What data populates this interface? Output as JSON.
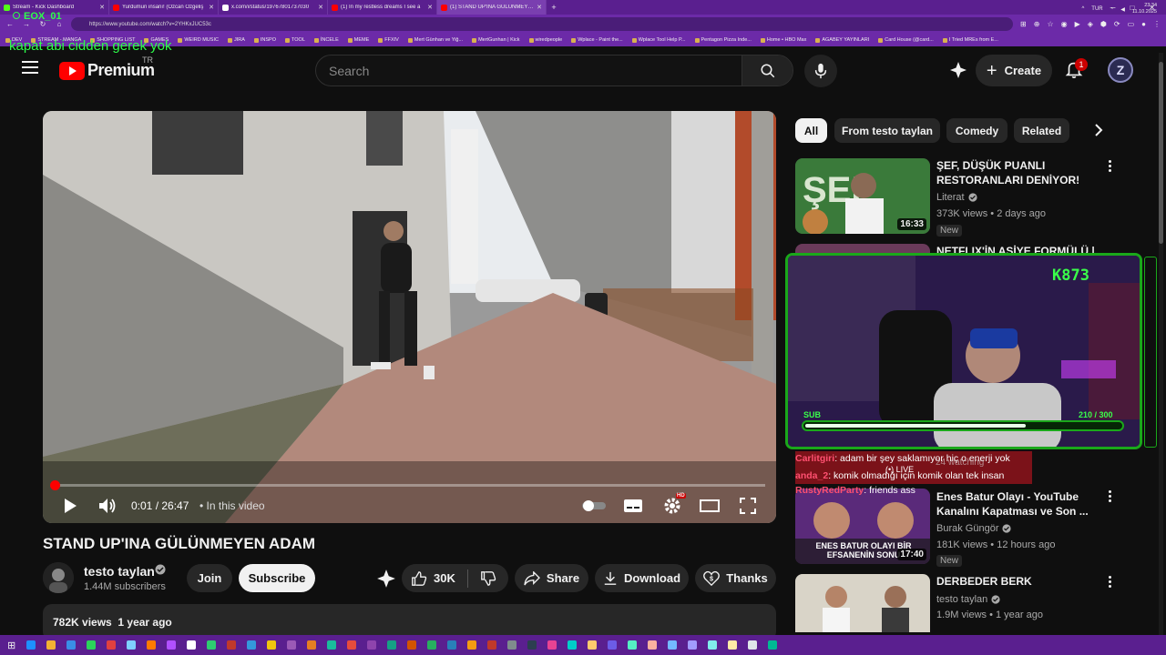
{
  "browser": {
    "tabs": [
      {
        "title": "Stream - Kick Dashboard",
        "color": "#53fc18"
      },
      {
        "title": "Yurdumun insanı! (Özcan Özgeliş",
        "color": "#ff0000"
      },
      {
        "title": "x.com/i/status/19767801737030",
        "color": "#ffffff"
      },
      {
        "title": "(1) In my restless dreams I see a",
        "color": "#ff0000"
      },
      {
        "title": "(1) STAND UP'INA GÜLÜNMEYEN",
        "color": "#ff0000",
        "active": true
      }
    ],
    "new_tab": "+",
    "url": "https://www.youtube.com/watch?v=2YHKxJUC53c",
    "bookmarks": [
      "DEV",
      "STREAM - MANGA",
      "SHOPPING LIST",
      "GAMES",
      "WEIRD MUSIC",
      "JIRA",
      "INSPO",
      "TOOL",
      "İNCELE",
      "MEME",
      "FFXIV",
      "Mert Günhan ve Yiğ...",
      "MertGunhan | Kick",
      "wiredpeople",
      "Wplace - Paint the...",
      "Wplace Tool Help P...",
      "Pentagon Pizza Inde...",
      "Home • HBO Max",
      "AGABEY YAYINLARI",
      "Card House (@card...",
      "I Tried MREs from E..."
    ]
  },
  "overlay": {
    "user": "EOX_01",
    "message": "kapat abi cidden gerek yok"
  },
  "masthead": {
    "logo_text": "Premium",
    "region": "TR",
    "search_placeholder": "Search",
    "create_label": "Create",
    "notification_count": "1",
    "avatar_letter": "Z"
  },
  "player": {
    "time": "0:01 / 26:47",
    "chapter": "• In this video",
    "progress_fraction": 0.001,
    "settings_badge": "HD"
  },
  "video": {
    "title": "STAND UP'INA GÜLÜNMEYEN ADAM",
    "channel": "testo taylan",
    "subscribers": "1.44M subscribers",
    "join_label": "Join",
    "subscribe_label": "Subscribe",
    "likes": "30K",
    "share_label": "Share",
    "download_label": "Download",
    "thanks_label": "Thanks",
    "views": "782K views",
    "age": "1 year ago"
  },
  "chips": [
    "All",
    "From testo taylan",
    "Comedy",
    "Related"
  ],
  "recommendations": [
    {
      "title": "ŞEF, DÜŞÜK PUANLI RESTORANLARI DENİYOR!",
      "channel": "Literat",
      "meta": "373K views • 2 days ago",
      "duration": "16:33",
      "badge": "New"
    },
    {
      "title": "NETFLIX'İN AŞİYE FORMÜLÜ | ...",
      "channel": "",
      "meta": "",
      "duration": "",
      "badge": ""
    },
    {
      "title": "Enes Batur Olayı - YouTube Kanalını Kapatması ve Son ...",
      "channel": "Burak Güngör",
      "meta": "181K views • 12 hours ago",
      "duration": "17:40",
      "badge": "New",
      "thumb_text": "ENES BATUR OLAYI BİR EFSANENİN SONU"
    },
    {
      "title": "DERBEDER BERK",
      "channel": "testo taylan",
      "meta": "1.9M views • 1 year ago",
      "duration": "",
      "badge": ""
    }
  ],
  "webcam": {
    "tag": "K873",
    "sub_label": "SUB",
    "sub_count": "210  /  300",
    "sub_fraction": 0.7,
    "rec_watching": "24 watching",
    "live_label": "LIVE"
  },
  "chat": [
    {
      "user": "Carlitgiri",
      "text": "adam bir şey saklamıyor hiç o enerji yok"
    },
    {
      "user": "anda_2",
      "text": "komik olmadığı için komik olan tek insan"
    },
    {
      "user": "RustyRedParty",
      "text": "friends ass"
    }
  ],
  "taskbar": {
    "lang": "TUR",
    "time": "23:34",
    "date": "11.10.2025"
  }
}
